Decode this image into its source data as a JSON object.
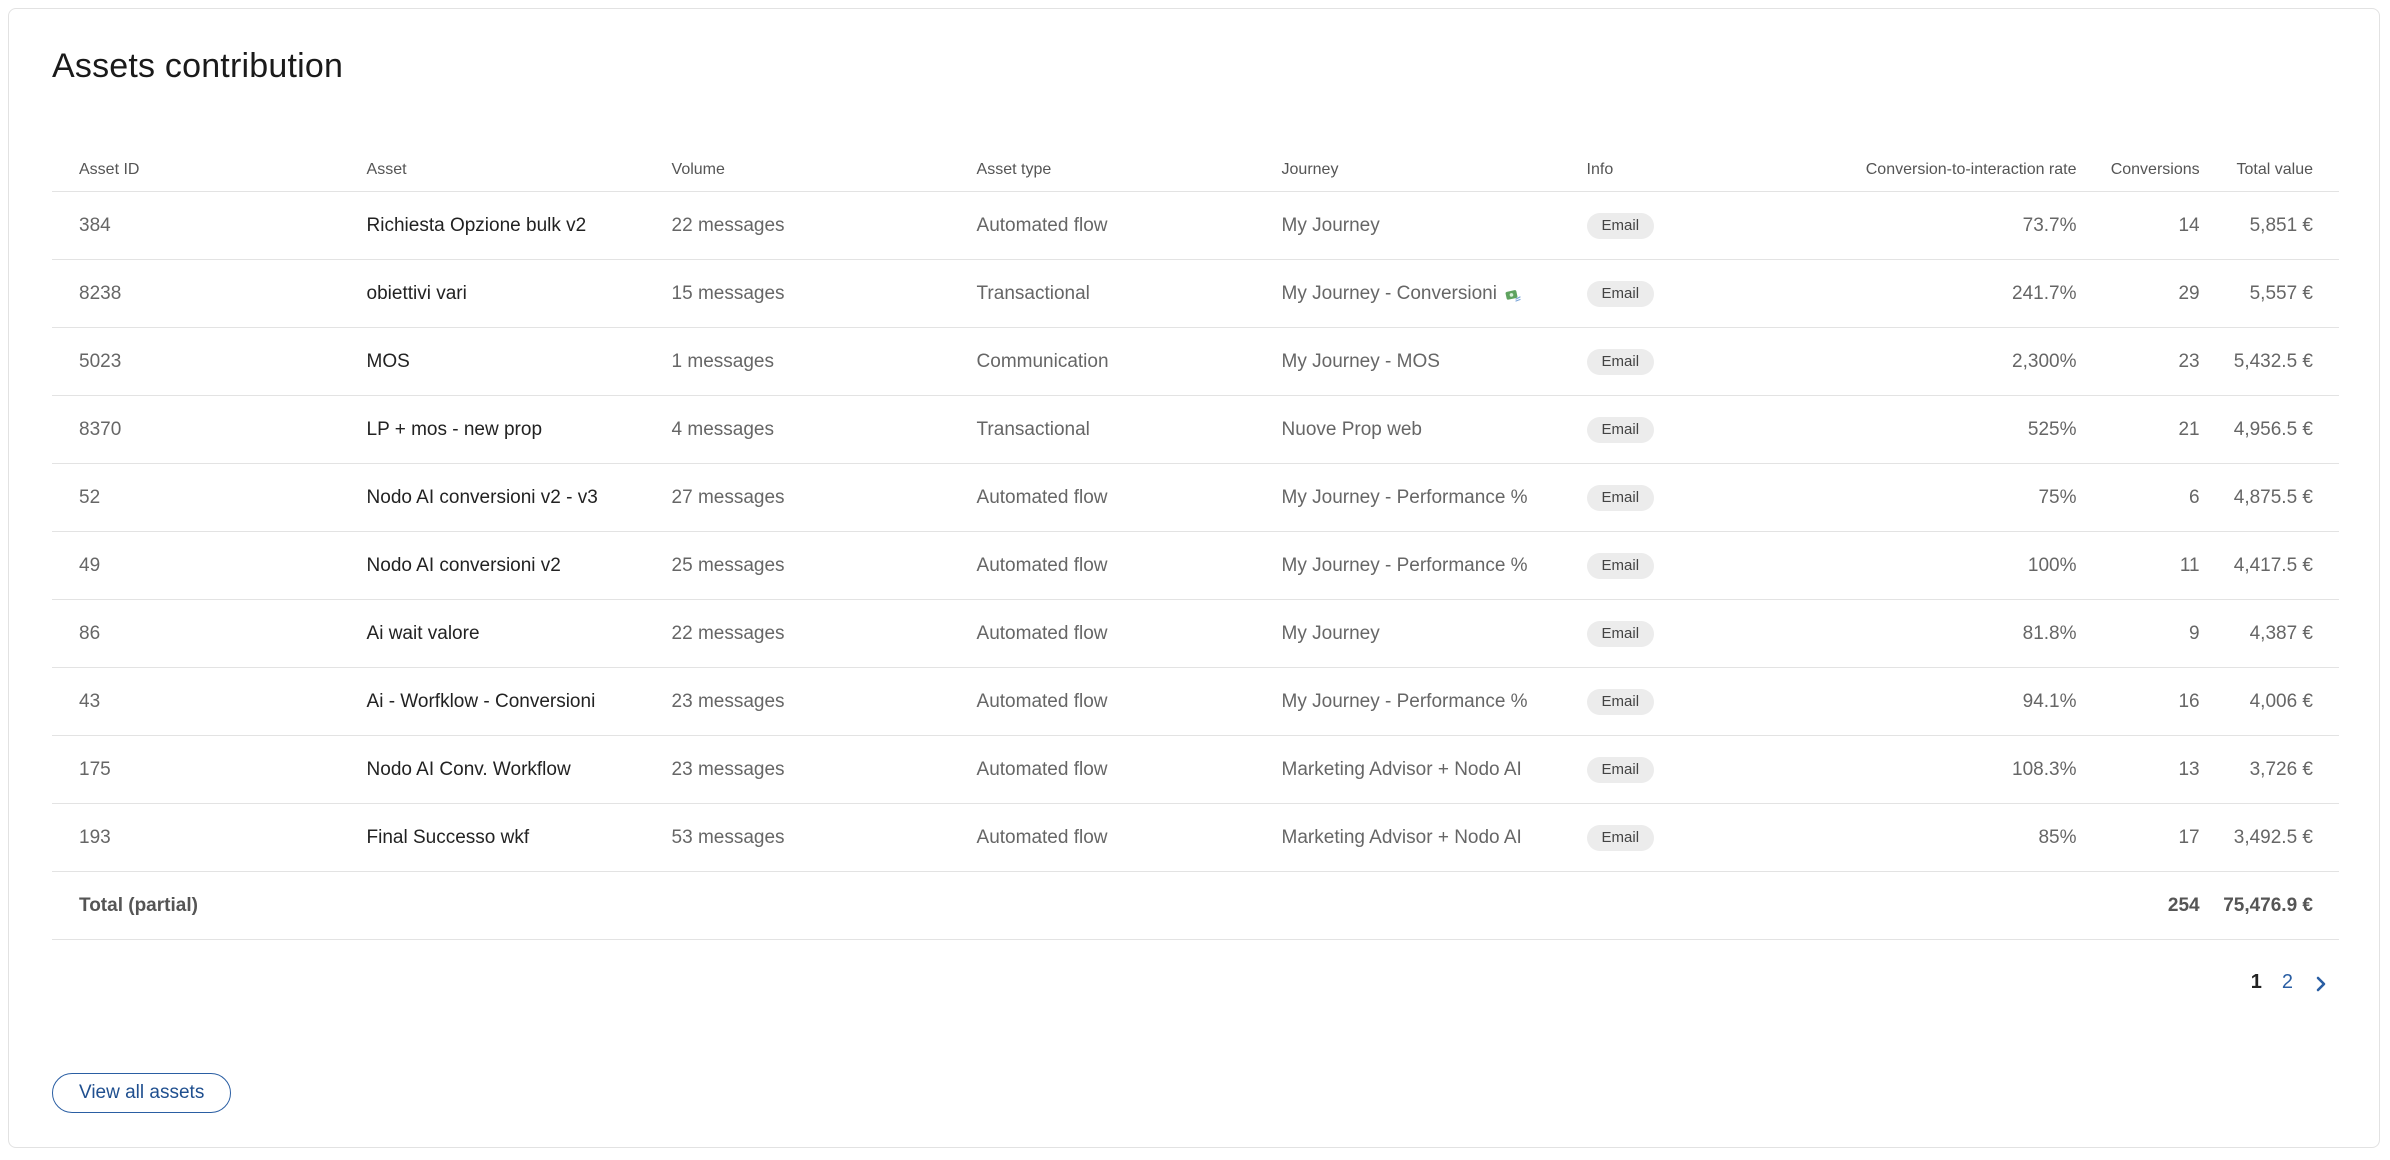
{
  "title": "Assets contribution",
  "colors": {
    "accent": "#2a5ea3",
    "badge_bg": "#ececec",
    "border": "#e3e3e3"
  },
  "table": {
    "columns": {
      "asset_id": "Asset ID",
      "asset": "Asset",
      "volume": "Volume",
      "asset_type": "Asset type",
      "journey": "Journey",
      "info": "Info",
      "rate": "Conversion-to-interaction rate",
      "conversions": "Conversions",
      "total_value": "Total value"
    },
    "rows": [
      {
        "asset_id": "384",
        "asset": "Richiesta Opzione bulk v2",
        "volume": "22 messages",
        "asset_type": "Automated flow",
        "journey": "My Journey",
        "journey_icon": "",
        "info": "Email",
        "rate": "73.7%",
        "conversions": "14",
        "total_value": "5,851 €"
      },
      {
        "asset_id": "8238",
        "asset": "obiettivi vari",
        "volume": "15 messages",
        "asset_type": "Transactional",
        "journey": "My Journey - Conversioni",
        "journey_icon": "money-with-wings-icon",
        "info": "Email",
        "rate": "241.7%",
        "conversions": "29",
        "total_value": "5,557 €"
      },
      {
        "asset_id": "5023",
        "asset": "MOS",
        "volume": "1 messages",
        "asset_type": "Communication",
        "journey": "My Journey - MOS",
        "journey_icon": "",
        "info": "Email",
        "rate": "2,300%",
        "conversions": "23",
        "total_value": "5,432.5 €"
      },
      {
        "asset_id": "8370",
        "asset": "LP + mos - new prop",
        "volume": "4 messages",
        "asset_type": "Transactional",
        "journey": "Nuove Prop web",
        "journey_icon": "",
        "info": "Email",
        "rate": "525%",
        "conversions": "21",
        "total_value": "4,956.5 €"
      },
      {
        "asset_id": "52",
        "asset": "Nodo AI conversioni v2 - v3",
        "volume": "27 messages",
        "asset_type": "Automated flow",
        "journey": "My Journey - Performance %",
        "journey_icon": "",
        "info": "Email",
        "rate": "75%",
        "conversions": "6",
        "total_value": "4,875.5 €"
      },
      {
        "asset_id": "49",
        "asset": "Nodo AI conversioni v2",
        "volume": "25 messages",
        "asset_type": "Automated flow",
        "journey": "My Journey - Performance %",
        "journey_icon": "",
        "info": "Email",
        "rate": "100%",
        "conversions": "11",
        "total_value": "4,417.5 €"
      },
      {
        "asset_id": "86",
        "asset": "Ai wait valore",
        "volume": "22 messages",
        "asset_type": "Automated flow",
        "journey": "My Journey",
        "journey_icon": "",
        "info": "Email",
        "rate": "81.8%",
        "conversions": "9",
        "total_value": "4,387 €"
      },
      {
        "asset_id": "43",
        "asset": "Ai - Worfklow - Conversioni",
        "volume": "23 messages",
        "asset_type": "Automated flow",
        "journey": "My Journey - Performance %",
        "journey_icon": "",
        "info": "Email",
        "rate": "94.1%",
        "conversions": "16",
        "total_value": "4,006 €"
      },
      {
        "asset_id": "175",
        "asset": "Nodo AI Conv. Workflow",
        "volume": "23 messages",
        "asset_type": "Automated flow",
        "journey": "Marketing Advisor + Nodo AI",
        "journey_icon": "",
        "info": "Email",
        "rate": "108.3%",
        "conversions": "13",
        "total_value": "3,726 €"
      },
      {
        "asset_id": "193",
        "asset": "Final Successo wkf",
        "volume": "53 messages",
        "asset_type": "Automated flow",
        "journey": "Marketing Advisor + Nodo AI",
        "journey_icon": "",
        "info": "Email",
        "rate": "85%",
        "conversions": "17",
        "total_value": "3,492.5 €"
      }
    ],
    "total": {
      "label": "Total (partial)",
      "conversions": "254",
      "total_value": "75,476.9 €"
    }
  },
  "pagination": {
    "pages": [
      "1",
      "2"
    ],
    "current": "1",
    "next_icon": "chevron-right-icon"
  },
  "view_all_button": "View all assets"
}
